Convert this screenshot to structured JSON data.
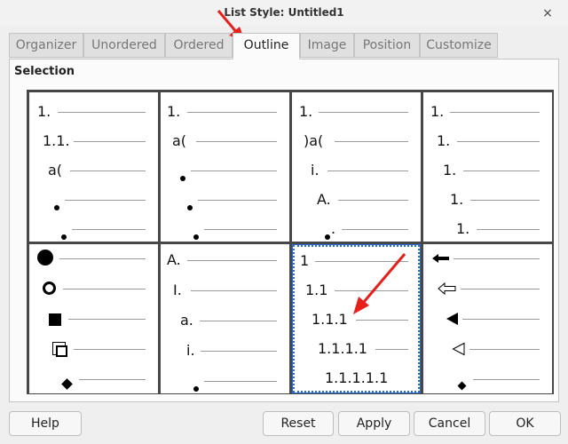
{
  "dialog": {
    "title": "List Style: Untitled1",
    "close_glyph": "×"
  },
  "tabs": [
    {
      "label": "Organizer",
      "active": false
    },
    {
      "label": "Unordered",
      "active": false
    },
    {
      "label": "Ordered",
      "active": false
    },
    {
      "label": "Outline",
      "active": true
    },
    {
      "label": "Image",
      "active": false
    },
    {
      "label": "Position",
      "active": false
    },
    {
      "label": "Customize",
      "active": false
    }
  ],
  "section": {
    "label": "Selection"
  },
  "presets": [
    {
      "selected": false,
      "levels": [
        {
          "text": "1."
        },
        {
          "text": "1.1."
        },
        {
          "text": "a("
        },
        {
          "text": "",
          "icon": "bullet-icon"
        },
        {
          "text": "",
          "icon": "bullet-icon"
        }
      ]
    },
    {
      "selected": false,
      "levels": [
        {
          "text": "1."
        },
        {
          "text": "a("
        },
        {
          "text": "",
          "icon": "bullet-icon"
        },
        {
          "text": "",
          "icon": "bullet-icon"
        },
        {
          "text": "",
          "icon": "bullet-icon"
        }
      ]
    },
    {
      "selected": false,
      "levels": [
        {
          "text": "1."
        },
        {
          "text": ")a("
        },
        {
          "text": "i."
        },
        {
          "text": "A."
        },
        {
          "text": ".",
          "icon": "bullet-icon"
        }
      ]
    },
    {
      "selected": false,
      "levels": [
        {
          "text": "1."
        },
        {
          "text": "1."
        },
        {
          "text": "1."
        },
        {
          "text": "1."
        },
        {
          "text": "1."
        }
      ]
    },
    {
      "selected": false,
      "levels": [
        {
          "text": "",
          "icon": "large-circle-icon"
        },
        {
          "text": "",
          "icon": "ring-icon"
        },
        {
          "text": "",
          "icon": "square-icon"
        },
        {
          "text": "",
          "icon": "box-3d-icon"
        },
        {
          "text": "",
          "icon": "diamond-icon"
        }
      ]
    },
    {
      "selected": false,
      "levels": [
        {
          "text": "A."
        },
        {
          "text": "I."
        },
        {
          "text": "a."
        },
        {
          "text": "i."
        },
        {
          "text": "",
          "icon": "bullet-icon"
        }
      ]
    },
    {
      "selected": true,
      "levels": [
        {
          "text": "1"
        },
        {
          "text": "1.1"
        },
        {
          "text": "1.1.1"
        },
        {
          "text": "1.1.1.1"
        },
        {
          "text": "1.1.1.1.1"
        }
      ]
    },
    {
      "selected": false,
      "levels": [
        {
          "text": "",
          "icon": "left-arrow-icon"
        },
        {
          "text": "",
          "icon": "outline-left-arrow-icon"
        },
        {
          "text": "",
          "icon": "left-triangle-icon"
        },
        {
          "text": "",
          "icon": "outline-left-triangle-icon"
        },
        {
          "text": "",
          "icon": "small-diamond-icon"
        }
      ]
    }
  ],
  "buttons": {
    "help": "Help",
    "reset": "Reset",
    "apply": "Apply",
    "cancel": "Cancel",
    "ok": "OK"
  },
  "colors": {
    "annotation": "#e8201c",
    "selection": "#2a6bd1"
  }
}
